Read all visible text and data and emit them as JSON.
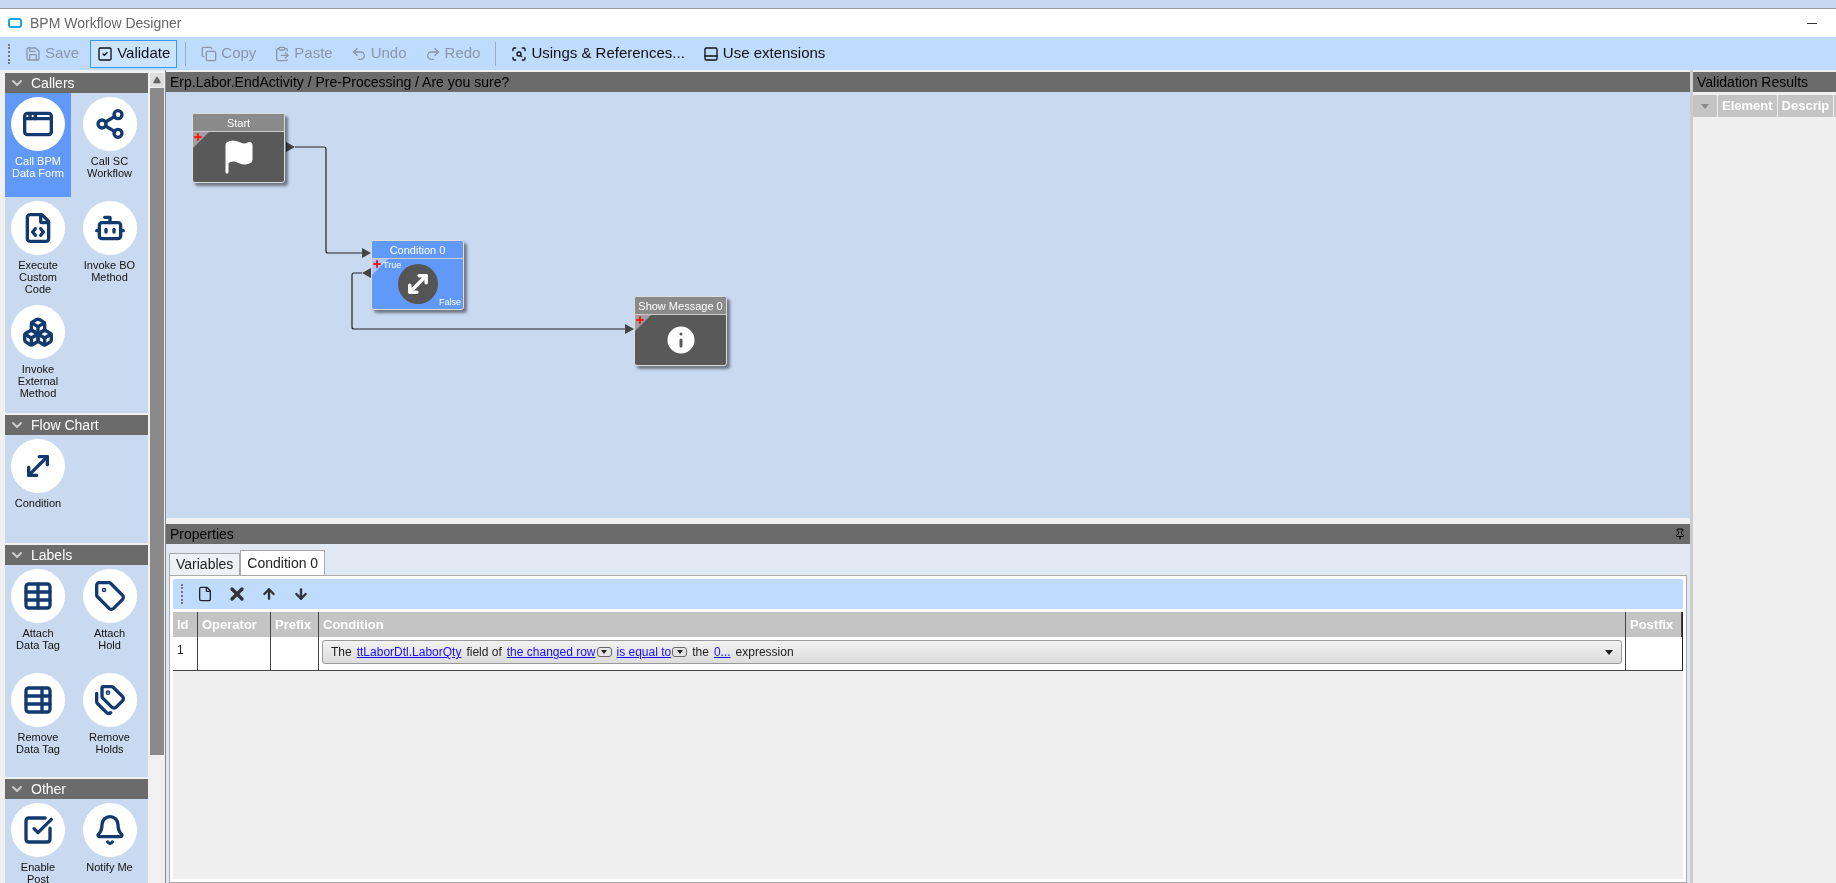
{
  "window": {
    "title": "BPM Workflow Designer"
  },
  "toolbar": {
    "groups": [
      {
        "buttons": [
          {
            "label": "Save",
            "disabled": true,
            "selected": false
          },
          {
            "label": "Validate",
            "disabled": false,
            "selected": true
          }
        ]
      },
      {
        "buttons": [
          {
            "label": "Copy",
            "disabled": true,
            "selected": false
          },
          {
            "label": "Paste",
            "disabled": true,
            "selected": false
          },
          {
            "label": "Undo",
            "disabled": true,
            "selected": false
          },
          {
            "label": "Redo",
            "disabled": true,
            "selected": false
          }
        ]
      },
      {
        "buttons": [
          {
            "label": "Usings & References...",
            "disabled": false,
            "selected": false
          },
          {
            "label": "Use extensions",
            "disabled": false,
            "selected": false
          }
        ]
      }
    ]
  },
  "palette": {
    "groups": [
      {
        "title": "Callers",
        "expanded": true,
        "items": [
          {
            "label": "Call BPM Data Form",
            "selected": true
          },
          {
            "label": "Call SC Workflow",
            "selected": false
          },
          {
            "label": "Execute Custom Code",
            "selected": false
          },
          {
            "label": "Invoke BO Method",
            "selected": false
          },
          {
            "label": "Invoke External Method",
            "selected": false
          }
        ]
      },
      {
        "title": "Flow Chart",
        "expanded": true,
        "items": [
          {
            "label": "Condition",
            "selected": false
          }
        ]
      },
      {
        "title": "Labels",
        "expanded": true,
        "items": [
          {
            "label": "Attach Data Tag",
            "selected": false
          },
          {
            "label": "Attach Hold",
            "selected": false
          },
          {
            "label": "Remove Data Tag",
            "selected": false
          },
          {
            "label": "Remove Holds",
            "selected": false
          }
        ]
      },
      {
        "title": "Other",
        "expanded": true,
        "items": [
          {
            "label": "Enable Post",
            "selected": false
          },
          {
            "label": "Notify Me",
            "selected": false
          }
        ]
      }
    ]
  },
  "canvas": {
    "breadcrumb": "Erp.Labor.EndActivity / Pre-Processing / Are you sure?",
    "nodes": [
      {
        "kind": "start",
        "title": "Start",
        "selected": false
      },
      {
        "kind": "condition",
        "title": "Condition 0",
        "selected": true,
        "true_label": "True",
        "false_label": "False"
      },
      {
        "kind": "message",
        "title": "Show Message 0",
        "selected": false
      }
    ]
  },
  "properties": {
    "title": "Properties",
    "tabs": [
      {
        "label": "Variables",
        "selected": false
      },
      {
        "label": "Condition 0",
        "selected": true
      }
    ],
    "table": {
      "columns": [
        "Id",
        "Operator",
        "Prefix",
        "Condition",
        "Postfix"
      ],
      "rows": [
        {
          "id": "1",
          "operator": "",
          "prefix": "",
          "postfix": "",
          "condition": [
            {
              "kind": "text",
              "text": "The"
            },
            {
              "kind": "link",
              "text": "ttLaborDtl.LaborQty"
            },
            {
              "kind": "text",
              "text": "field of"
            },
            {
              "kind": "choice",
              "text": "the changed row"
            },
            {
              "kind": "choice",
              "text": "is equal to"
            },
            {
              "kind": "text",
              "text": "the"
            },
            {
              "kind": "link",
              "text": "0..."
            },
            {
              "kind": "text",
              "text": "expression"
            }
          ]
        }
      ]
    }
  },
  "validation": {
    "title": "Validation Results",
    "columns": [
      "Element",
      "Descrip"
    ]
  }
}
